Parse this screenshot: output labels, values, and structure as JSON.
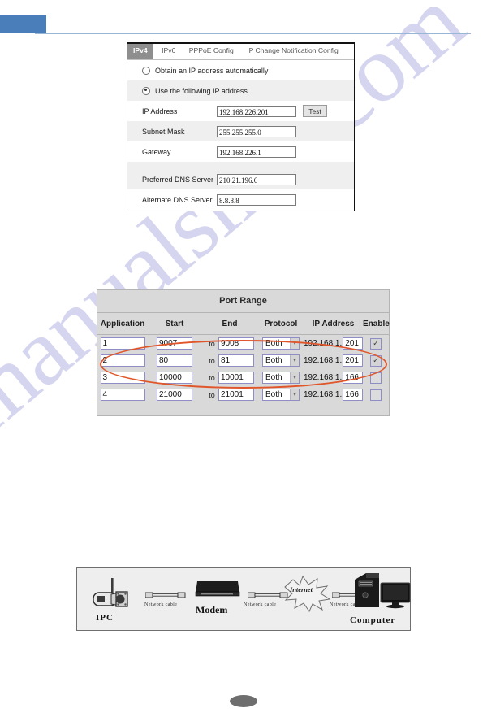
{
  "header": {
    "band_color": "#4a7ebb",
    "rule_color": "#8faed4"
  },
  "watermark": {
    "text": "manualslive.com",
    "color": "#c7c8ea"
  },
  "ipv4_panel": {
    "tabs": [
      {
        "label": "IPv4",
        "active": true
      },
      {
        "label": "IPv6",
        "active": false
      },
      {
        "label": "PPPoE Config",
        "active": false
      },
      {
        "label": "IP Change Notification Config",
        "active": false
      }
    ],
    "radios": [
      {
        "label": "Obtain an IP address automatically",
        "selected": false
      },
      {
        "label": "Use the following IP address",
        "selected": true
      }
    ],
    "fields": [
      {
        "label": "IP Address",
        "value": "192.168.226.201"
      },
      {
        "label": "Subnet Mask",
        "value": "255.255.255.0"
      },
      {
        "label": "Gateway",
        "value": "192.168.226.1"
      },
      {
        "label": "Preferred DNS Server",
        "value": "210.21.196.6"
      },
      {
        "label": "Alternate DNS Server",
        "value": "8.8.8.8"
      }
    ],
    "test_button": "Test"
  },
  "port_table": {
    "title": "Port Range",
    "columns": [
      "Application",
      "Start",
      "End",
      "Protocol",
      "IP Address",
      "Enable"
    ],
    "to_label": "to",
    "ip_prefix": "192.168.1.",
    "highlight_color": "#e0562a",
    "rows": [
      {
        "application": "1",
        "start": "9007",
        "end": "9008",
        "protocol": "Both",
        "ip_octet": "201",
        "enable": true
      },
      {
        "application": "2",
        "start": "80",
        "end": "81",
        "protocol": "Both",
        "ip_octet": "201",
        "enable": true
      },
      {
        "application": "3",
        "start": "10000",
        "end": "10001",
        "protocol": "Both",
        "ip_octet": "166",
        "enable": false
      },
      {
        "application": "4",
        "start": "21000",
        "end": "21001",
        "protocol": "Both",
        "ip_octet": "166",
        "enable": false
      }
    ]
  },
  "network_diagram": {
    "nodes": [
      {
        "name": "IPC"
      },
      {
        "name": "Modem"
      },
      {
        "name": "Internet"
      },
      {
        "name": "Computer"
      }
    ],
    "cable_labels": [
      "Network cable",
      "Network cable",
      "Network cable"
    ]
  }
}
